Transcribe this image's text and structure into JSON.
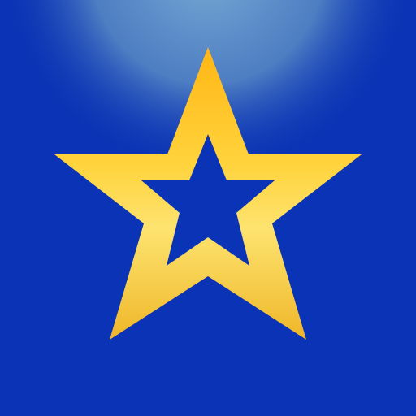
{
  "icon": {
    "name": "star-icon",
    "colors": {
      "background": "#0a33b5",
      "glow_center": "#5c8fc7",
      "star_top": "#ffbe16",
      "star_bottom": "#f2b92b",
      "star_mid_light": "#fde06a",
      "inner_star": "#0a33b5"
    }
  }
}
